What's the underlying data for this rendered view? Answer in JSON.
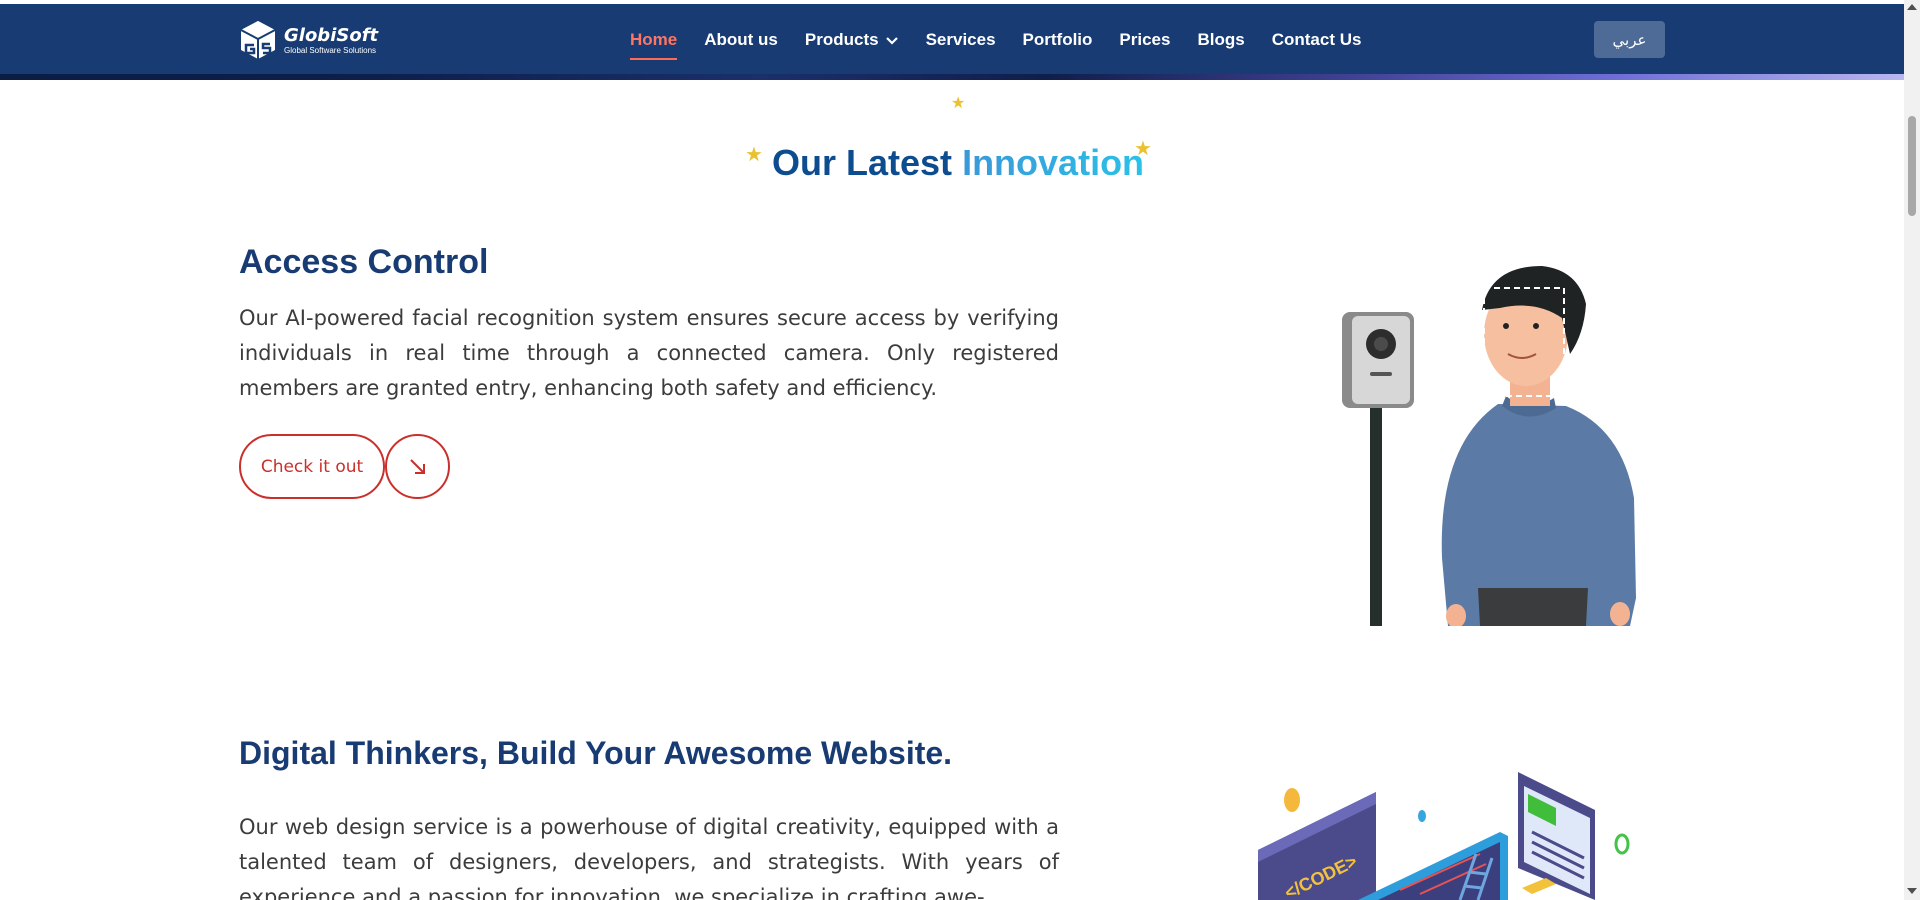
{
  "navbar": {
    "logo_title": "GlobiSoft",
    "logo_subtitle": "Global Software Solutions",
    "items": [
      {
        "label": "Home",
        "active": true
      },
      {
        "label": "About us"
      },
      {
        "label": "Products",
        "has_dropdown": true
      },
      {
        "label": "Services"
      },
      {
        "label": "Portfolio"
      },
      {
        "label": "Prices"
      },
      {
        "label": "Blogs"
      },
      {
        "label": "Contact Us"
      }
    ],
    "language_button": "عربي"
  },
  "section": {
    "heading_part1": "Our Latest",
    "heading_part2": "Innovation"
  },
  "access_control": {
    "title": "Access Control",
    "description": "Our AI-powered facial recognition system ensures secure access by verifying individuals in real time through a connected camera. Only registered members are granted entry, enhancing both safety and efficiency.",
    "button_label": "Check it out",
    "arrow_icon": "↘"
  },
  "web_design": {
    "title": "Digital Thinkers, Build Your Awesome Website.",
    "description": "Our web design service is a powerhouse of digital creativity, equipped with a talented team of designers, developers, and strategists. With years of experience and a passion for innovation, we specialize in crafting awe-",
    "illustration_text": "</CODE>"
  },
  "colors": {
    "nav_bg": "#173b72",
    "active": "#ff7563",
    "title": "#173b72",
    "accent_red": "#c9302c"
  }
}
